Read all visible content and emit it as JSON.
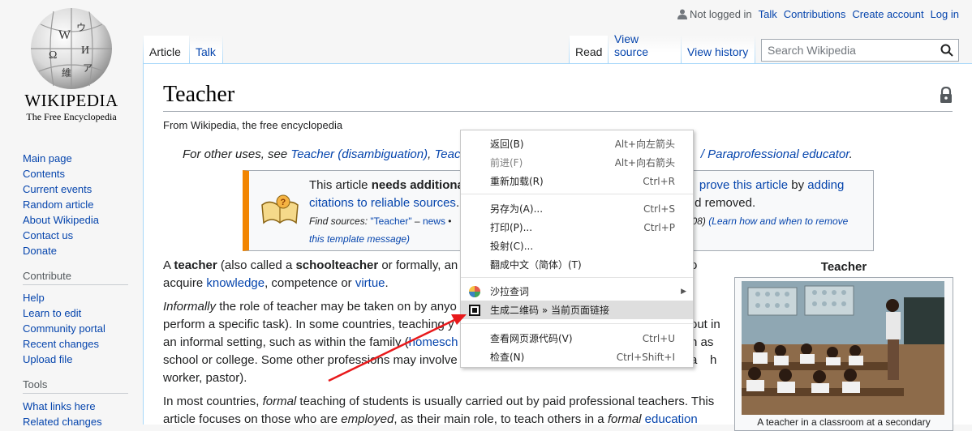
{
  "logo": {
    "wordmark": "WIKIPEDIA",
    "tagline": "The Free Encyclopedia",
    "globe_glyphs": [
      "W",
      "Ω",
      "維",
      "И",
      "ウ",
      "ア"
    ]
  },
  "personal": {
    "not_logged_in": "Not logged in",
    "talk": "Talk",
    "contributions": "Contributions",
    "create_account": "Create account",
    "login": "Log in"
  },
  "sidebar": {
    "nav": [
      "Main page",
      "Contents",
      "Current events",
      "Random article",
      "About Wikipedia",
      "Contact us",
      "Donate"
    ],
    "contribute_heading": "Contribute",
    "contribute": [
      "Help",
      "Learn to edit",
      "Community portal",
      "Recent changes",
      "Upload file"
    ],
    "tools_heading": "Tools",
    "tools": [
      "What links here",
      "Related changes"
    ]
  },
  "tabs": {
    "article": "Article",
    "talk": "Talk",
    "read": "Read",
    "view_source": "View source",
    "view_history": "View history"
  },
  "search": {
    "placeholder": "Search Wikipedia"
  },
  "article": {
    "title": "Teacher",
    "site_sub": "From Wikipedia, the free encyclopedia",
    "hatnote": {
      "p1": "For other uses, see ",
      "l1": "Teacher (disambiguation)",
      "p2": ", ",
      "l2": "Teach",
      "l3": "/ Paraprofessional educator",
      "p3": "."
    },
    "ambox": {
      "p1": "This article ",
      "b1": "needs additiona",
      "l1": "prove this article",
      "p2": " by ",
      "l2": "adding",
      "l3": "citations to reliable sources",
      "p3": ".",
      "p4": "d removed.",
      "find": "Find sources: ",
      "q": "\"Teacher\"",
      "dash": " – ",
      "news": "news",
      "dot": " •",
      "date": "08)",
      "learn": "(Learn how and when to remove",
      "tm": "this template message)"
    },
    "para1": {
      "p1": "A ",
      "b1": "teacher",
      "p2": " (also called a ",
      "b2": "schoolteacher",
      "p3": " or formally, an ",
      "tail": "o",
      "p4": "acquire ",
      "l1": "knowledge",
      "p5": ", competence or ",
      "l2": "virtue",
      "p6": "."
    },
    "para2": {
      "i1": "Informally",
      "p1": " the role of teacher may be taken on by anyo",
      "p2": "perform a specific task). In some countries, teaching y",
      "tail2": "out in",
      "p3": "an informal setting, such as within the family (",
      "l1": "homesch",
      "tail3": "n as a",
      "p4": "school or college. Some other professions may involve",
      "tail4": "h",
      "p5": "worker, pastor)."
    },
    "para3": {
      "p1": "In most countries, ",
      "i1": "formal",
      "p2": " teaching of students is usually carried out by paid professional teachers. This",
      "p3": "article focuses on those who are ",
      "i2": "employed",
      "p4": ", as their main role, to teach others in a ",
      "i3": "formal",
      "l1": " education"
    }
  },
  "infobox": {
    "title": "Teacher",
    "caption": "A teacher in a classroom at a secondary"
  },
  "context_menu": {
    "items": [
      {
        "label": "返回(B)",
        "shortcut": "Alt+向左箭头"
      },
      {
        "label": "前进(F)",
        "shortcut": "Alt+向右箭头"
      },
      {
        "label": "重新加载(R)",
        "shortcut": "Ctrl+R"
      },
      {
        "label": "另存为(A)...",
        "shortcut": "Ctrl+S"
      },
      {
        "label": "打印(P)...",
        "shortcut": "Ctrl+P"
      },
      {
        "label": "投射(C)...",
        "shortcut": ""
      },
      {
        "label": "翻成中文（简体）(T)",
        "shortcut": ""
      },
      {
        "label": "沙拉查词",
        "shortcut": ""
      },
      {
        "label": "生成二维码 » 当前页面链接",
        "shortcut": ""
      },
      {
        "label": "查看网页源代码(V)",
        "shortcut": "Ctrl+U"
      },
      {
        "label": "检查(N)",
        "shortcut": "Ctrl+Shift+I"
      }
    ]
  },
  "colors": {
    "link": "#0645ad",
    "ambox_stripe": "#f28500",
    "annotation_arrow": "#e8191b"
  }
}
